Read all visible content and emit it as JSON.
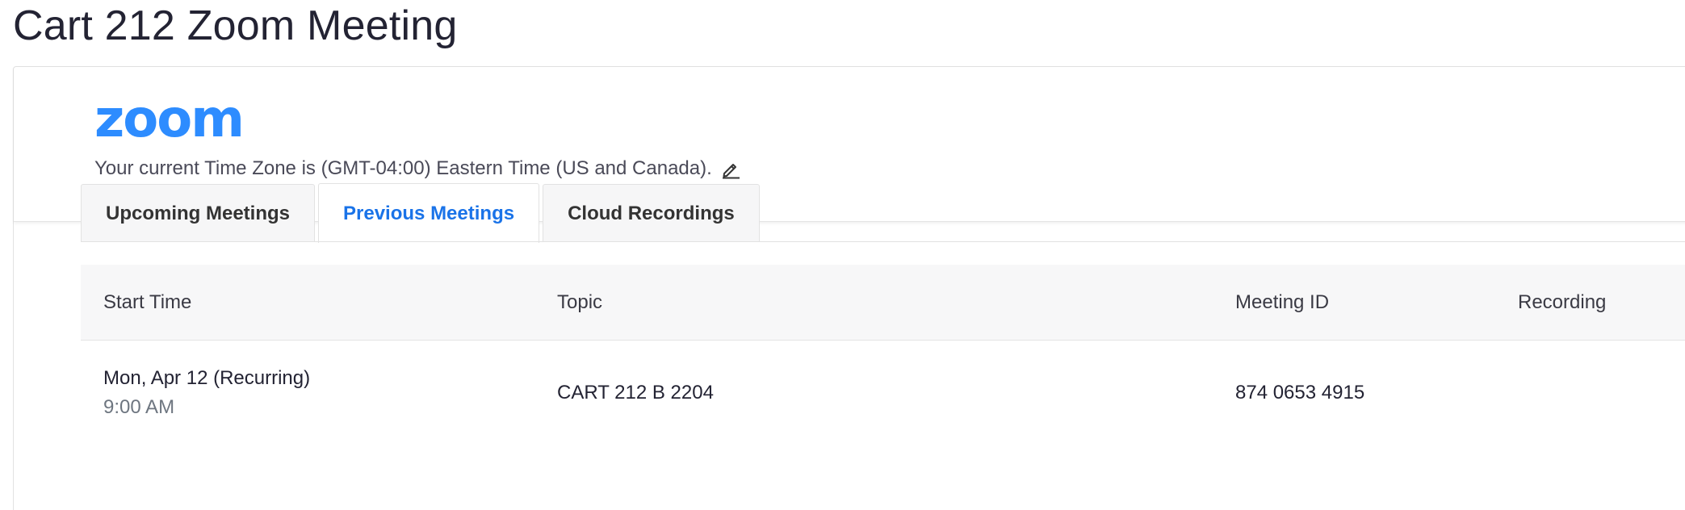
{
  "page": {
    "title": "Cart 212 Zoom Meeting"
  },
  "header": {
    "logo_text": "zoom",
    "logo_color": "#2D8CFF",
    "timezone_text": "Your current Time Zone is (GMT-04:00) Eastern Time (US and Canada).",
    "edit_icon": "pencil-icon"
  },
  "tabs": [
    {
      "label": "Upcoming Meetings",
      "active": false
    },
    {
      "label": "Previous Meetings",
      "active": true
    },
    {
      "label": "Cloud Recordings",
      "active": false
    }
  ],
  "table": {
    "columns": [
      "Start Time",
      "Topic",
      "Meeting ID",
      "Recording"
    ],
    "rows": [
      {
        "start_date": "Mon, Apr 12 (Recurring)",
        "start_time": "9:00 AM",
        "topic": "CART 212 B 2204",
        "meeting_id": "874 0653 4915",
        "recording": ""
      }
    ]
  },
  "colors": {
    "accent": "#1A73E8",
    "title": "#232333",
    "muted": "#6E7680"
  }
}
